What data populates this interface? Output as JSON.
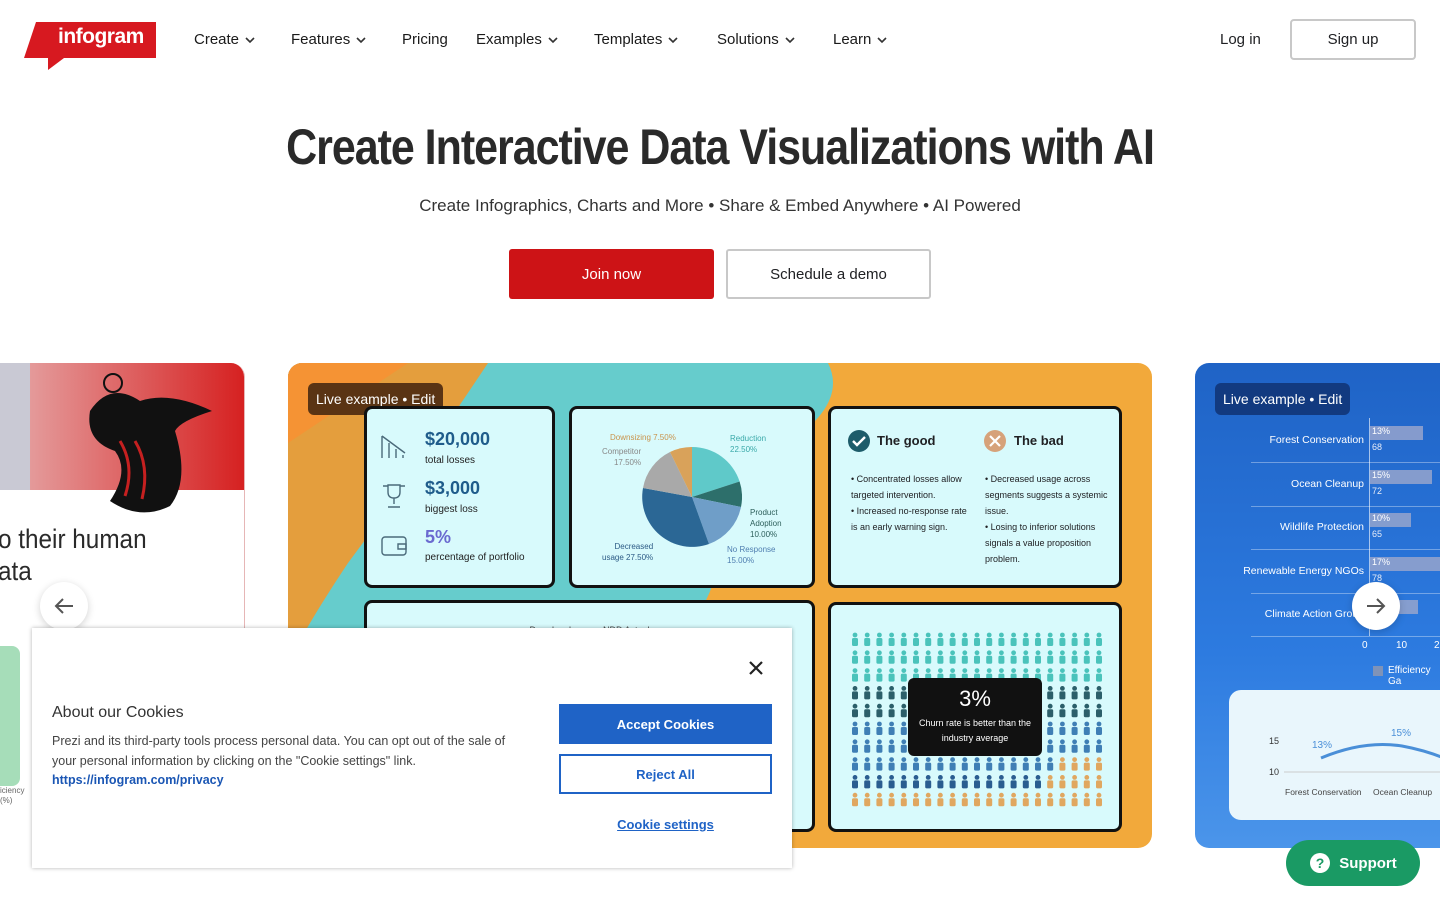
{
  "logo": {
    "text": "infogram",
    "brand_color": "#d71920"
  },
  "nav": {
    "items": [
      "Create",
      "Features",
      "Pricing",
      "Examples",
      "Templates",
      "Solutions",
      "Learn"
    ],
    "login": "Log in",
    "signup": "Sign up"
  },
  "hero": {
    "title": "Create Interactive Data Visualizations with AI",
    "subtitle": "Create Infographics, Charts and More • Share & Embed Anywhere • AI Powered",
    "join": "Join now",
    "demo": "Schedule a demo"
  },
  "carousel": {
    "left_card": {
      "text_line1": "o their human",
      "text_line2": "ata",
      "small_label": "iciency\n(%)"
    },
    "main_card": {
      "badge": "Live example • Edit",
      "stats": [
        {
          "value": "$20,000",
          "label": "total losses",
          "icon": "chart-down-icon"
        },
        {
          "value": "$3,000",
          "label": "biggest loss",
          "icon": "trophy-icon"
        },
        {
          "value": "5%",
          "label": "percentage of portfolio",
          "icon": "wallet-icon"
        }
      ],
      "pie": {
        "downsizing": "Downsizing 7.50%",
        "competitor": "Competitor\n17.50%",
        "reduction": "Reduction\n22.50%",
        "product": "Product\nAdoption\n10.00%",
        "noresp": "No Response\n15.00%",
        "decreased": "Decreased\nusage 27.50%"
      },
      "good": {
        "title": "The good",
        "items": [
          "Concentrated losses allow targeted intervention.",
          "Increased no-response rate is an early warning sign."
        ]
      },
      "bad": {
        "title": "The bad",
        "items": [
          "Decreased usage across segments suggests a systemic issue.",
          "Losing to inferior solutions signals a value proposition problem."
        ]
      },
      "churn": {
        "value": "3%",
        "label": "Churn rate is better than the industry average"
      },
      "bottom_chart_title": "Dorodogul occuro NDD Actual"
    },
    "right_card": {
      "badge": "Live example • Edit",
      "rows": [
        {
          "label": "Forest Conservation",
          "pct": "13%",
          "val": "68"
        },
        {
          "label": "Ocean Cleanup",
          "pct": "15%",
          "val": "72"
        },
        {
          "label": "Wildlife Protection",
          "pct": "10%",
          "val": "65"
        },
        {
          "label": "Renewable Energy NGOs",
          "pct": "17%",
          "val": "78"
        },
        {
          "label": "Climate Action Group",
          "pct": "",
          "val": ""
        }
      ],
      "axis": [
        "0",
        "10",
        "2"
      ],
      "legend": "Efficiency Ga",
      "line": {
        "y15": "15",
        "y10": "10",
        "p1": "13%",
        "p2": "15%",
        "x1": "Forest Conservation",
        "x2": "Ocean Cleanup"
      }
    }
  },
  "cookie": {
    "title": "About our Cookies",
    "body": "Prezi and its third-party tools process personal data. You can opt out of the sale of your personal information by clicking on the \"Cookie settings\" link.",
    "link": "https://infogram.com/privacy",
    "accept": "Accept Cookies",
    "reject": "Reject All",
    "settings": "Cookie settings"
  },
  "support": "Support"
}
